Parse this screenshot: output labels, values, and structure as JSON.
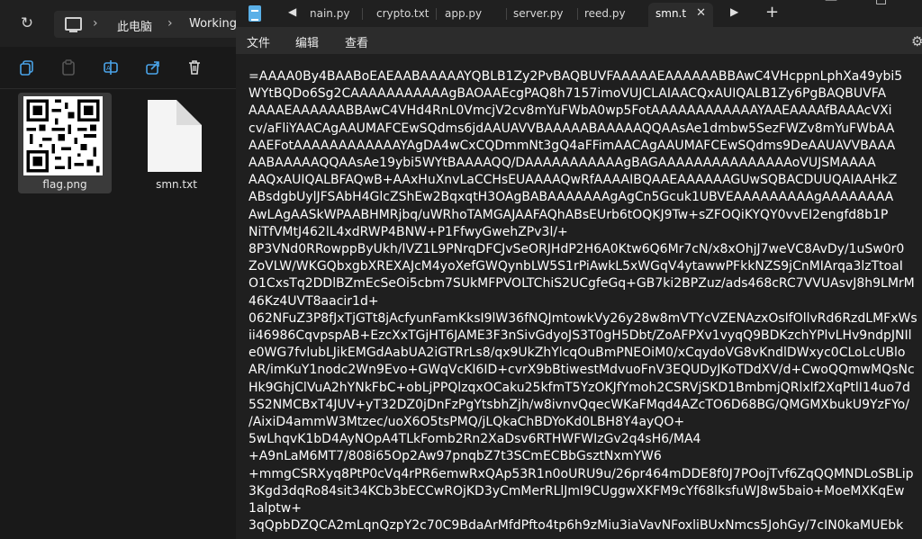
{
  "explorer": {
    "breadcrumb": [
      "此电脑",
      "Working"
    ],
    "files": [
      {
        "name": "flag.png",
        "type": "image"
      },
      {
        "name": "smn.txt",
        "type": "text"
      }
    ]
  },
  "notepad": {
    "tabs": [
      "nain.py",
      "crypto.txt",
      "app.py",
      "server.py",
      "reed.py",
      "smn.t"
    ],
    "menu": [
      "文件",
      "编辑",
      "查看"
    ],
    "content": [
      "=AAAA0By4BAABoEAEAABAAAAAYQBLB1Zy2PvBAQBUVFAAAAAEAAAAAABBAwC4VHcppnLphXa49ybi5",
      "WYtBQDo6Sg2CAAAAAAAAAAAgBAOAAEcgPAQ8h7157imoVUJCLAIAACQxAUIQALB1Zy6PgBAQBUVFA",
      "AAAAEAAAAAABBAwC4VHd4RnL0VmcjV2cv8mYuFWbA0wp5FotAAAAAAAAAAAAYAAEAAAAfBAAAcVXi",
      "cv/aFliYAACAgAAUMAFCEwSQdms6jdAAUAVVBAAAAABAAAAAQQAAsAe1dmbw5SezFWZv8mYuFWbAA",
      "AAEFotAAAAAAAAAAAAYAgDA4wCxCQDmmNt3gQ4aFFimAACAgAAUMAFCEwSQdms9DeAAUAVVBAAA",
      "AABAAAAAQQAAsAe19ybi5WYtBAAAAQQ/DAAAAAAAAAAAgBAGAAAAAAAAAAAAAAAoVUJSMAAAA",
      "AAQxAUIQALBFAQwB+AAxHuXnvLaCCHsEUAAAAQwRfAAAAIBQAAEAAAAAAGUwSQBACDUUQAIAAHkZ",
      "ABsdgbUylJFSAbH4GlcZShEw2BqxqtH3OAgBABAAAAAAAgAgCn5Gcuk1UBVEAAAAAAAAAgAAAAAAAA",
      "AwLAgAASkWPAABHMRjbq/uWRhoTAMGAJAAFAQhABsEUrb6tOQKJ9Tw+sZFOQiKYQY0vvEI2engfd8b1P",
      "NiTfVMtJ462lL4xdRWP4BNW+P1FfwyGwehZPv3l/+",
      "8P3VNd0RRowppByUkh/lVZ1L9PNrqDFCJvSeORJHdP2H6A0Ktw6Q6Mr7cN/x8xOhjJ7weVC8AvDy/1uSw0r0",
      "ZoVLW/WKGQbxgbXREXAJcM4yoXefGWQynbLW5S1rPiAwkL5xWGqV4ytawwPFkkNZS9jCnMIArqa3lzTtoaI",
      "O1CxsTq2DDlBZmEcSeOi5cbm7SUkMFPVOLTChiS2UCgfeGq+GB7ki2BPZuz/ads468cRC7VVUAsvJ8h9LMrM",
      "46Kz4UVT8aacir1d+",
      "062NFuZ3P8fJxTjGTt8jAcfyunFamKksI9lW36fNQJmtowkVy26y28w8mVTYcVZENAzxOsIfOllvRd6RzdLMFxWs",
      "ii46986CqvpspAB+EzcXxTGjHT6JAME3F3nSivGdyoJS3T0gH5Dbt/ZoAFPXv1vyqQ9BDKzchYPlvLHv9ndpJNIl",
      "e0WG7fvlubLJikEMGdAabUA2iGTRrLs8/qx9UkZhYlcqOuBmPNEOiM0/xCqydoVG8vKndlDWxyc0CLoLcUBlo",
      "AR/imKuY1nodc2Wn9Evo+GWqVcKI6ID+cvrX9bBtiwestMdvuoFnV3EQUDyJKoTDdXV/d+CwoQQmwMQsNc",
      "Hk9GhjClVuA2hYNkFbC+obLjPPQlzqxOCaku25kfmT5YzOKJfYmoh2CSRVjSKD1BmbmjQRlxlf2XqPtlI14uo7d",
      "5S2NMCBxT4JUV+yT32DZ0jDnFzPgYtsbhZjh/w8ivnvQqecWKaFMqd4AZcTO6D68BG/QMGMXbukU9YzFYo/",
      "/AixiD4ammW3Mtzec/uoX6O5tsPMQ/jLQkaChBDYoKd0LBH8Y4ayQO+",
      "5wLhqvK1bD4AyNOpA4TLkFomb2Rn2XaDsv6RTHWFWIzGv2q4sH6/MA4",
      "+A9nLaM6MT7/808i65Op2Aw97pnqbZ7t3SCmECBbGsztNxmYW6",
      "+mmgCSRXyq8PtP0cVq4rPR6emwRxQAp53R1n0oURU9u/26pr464mDDE8f0J7POojTvf6ZqQQMNDLoSBLip",
      "3Kgd3dqRo84sit34KCb3bECCwROjKD3yCmMerRLlJmI9CUggwXKFM9cYf68lksfuWJ8w5baio+MoeMXKqEw",
      "1alptw+",
      "3qQpbDZQCA2mLqnQzpY2c70C9BdaArMfdPfto4tp6h9zMiu3iaVavNFoxliBUxNmcs5JohGy/7cIN0kaMUEbk"
    ]
  }
}
